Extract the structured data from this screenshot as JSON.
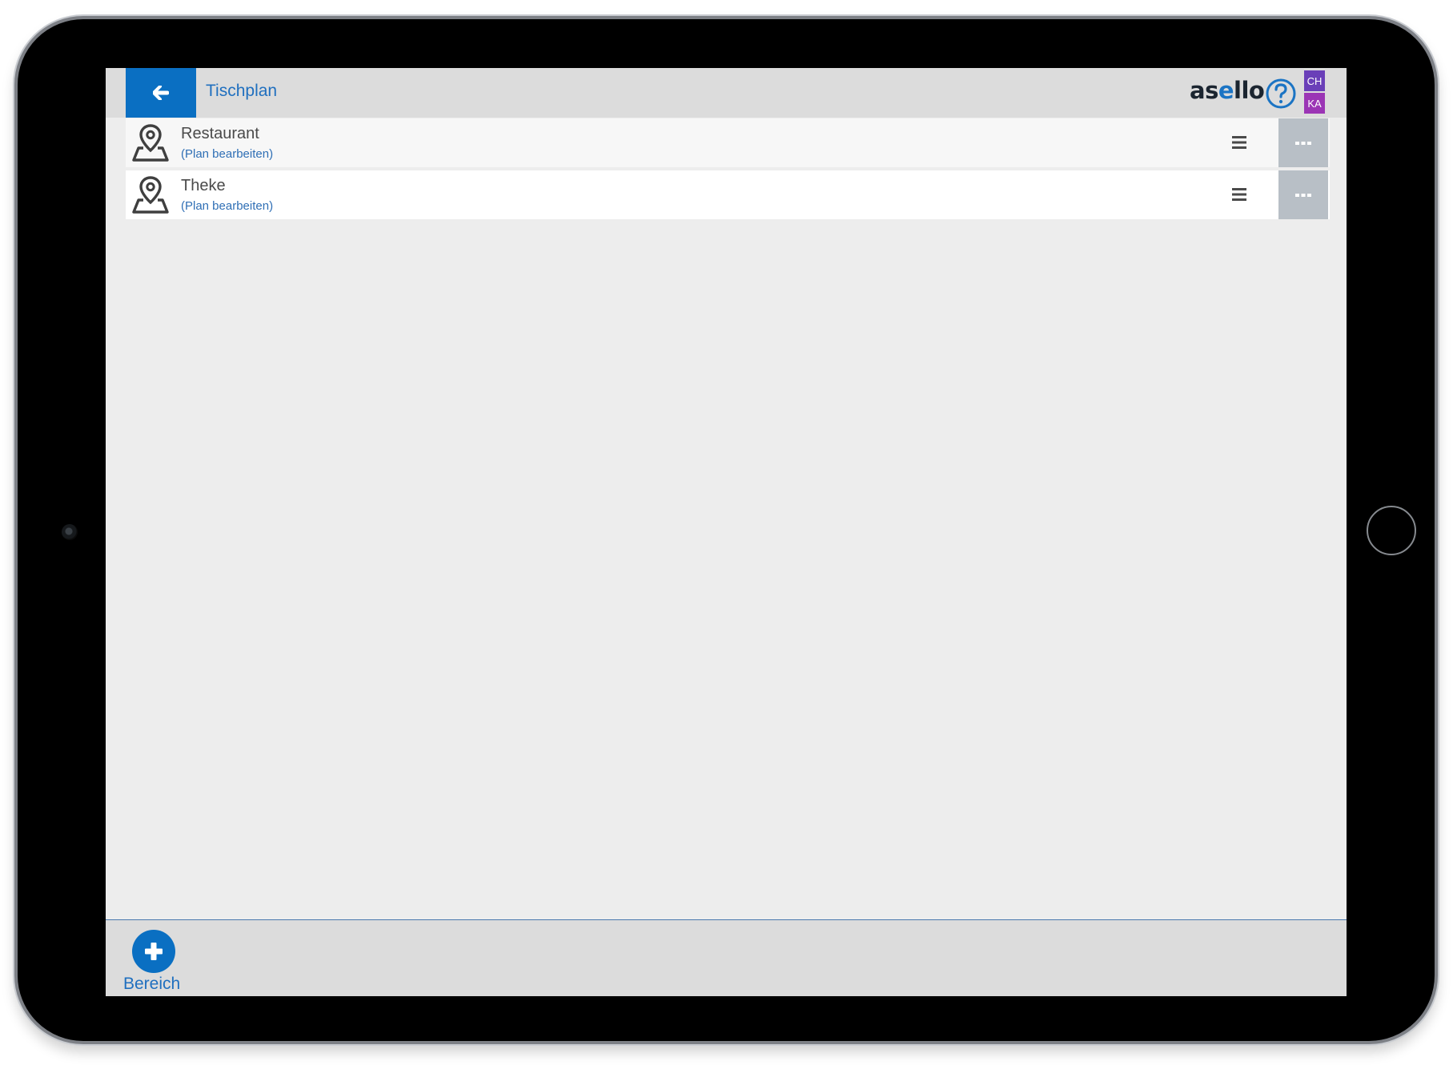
{
  "header": {
    "title": "Tischplan",
    "back_icon": "arrow-left-icon",
    "logo_prefix": "as",
    "logo_accent": "e",
    "logo_suffix": "llo",
    "help_icon": "question-circle-icon",
    "badges": [
      "CH",
      "KA"
    ]
  },
  "areas": [
    {
      "name": "Restaurant",
      "edit_label": "(Plan bearbeiten)",
      "icon": "map-pin-icon"
    },
    {
      "name": "Theke",
      "edit_label": "(Plan bearbeiten)",
      "icon": "map-pin-icon"
    }
  ],
  "footer": {
    "add_label": "Bereich",
    "add_icon": "plus-icon"
  },
  "colors": {
    "accent": "#0a6fc2",
    "header_bg": "#dcdcdc",
    "content_bg": "#ededed",
    "more_button_bg": "#b8bfc6",
    "badge_ch": "#6a3fb8",
    "badge_ka": "#9b35b5"
  }
}
